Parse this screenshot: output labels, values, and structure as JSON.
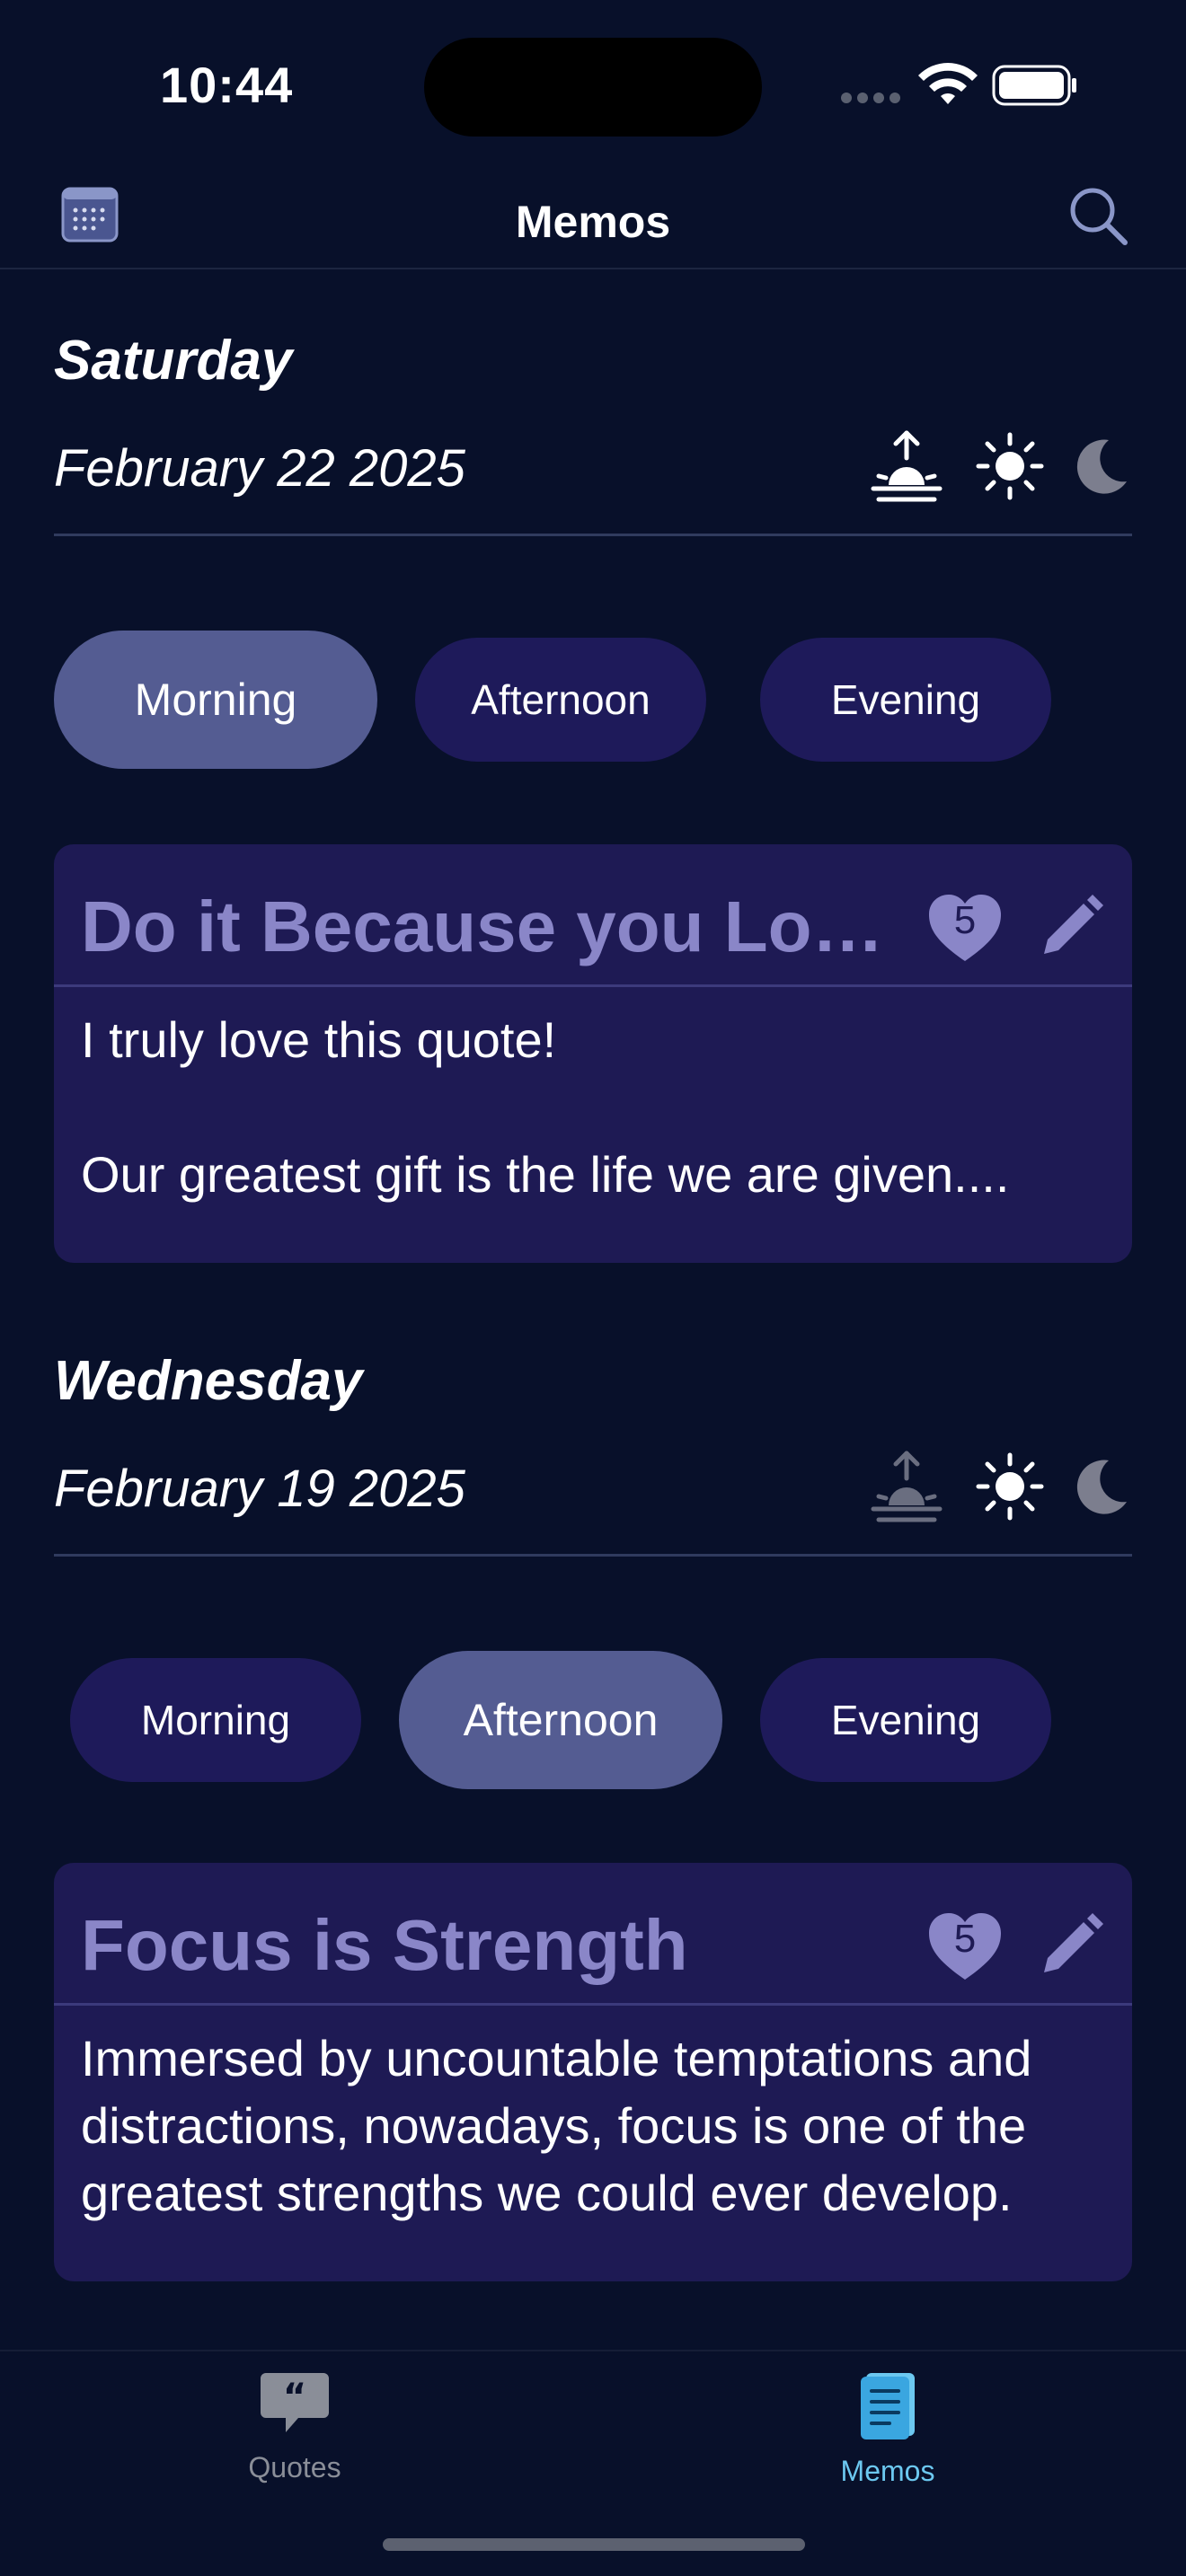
{
  "status_bar": {
    "time": "10:44"
  },
  "nav": {
    "title": "Memos"
  },
  "days": [
    {
      "day": "Saturday",
      "date": "February 22 2025",
      "periods": [
        {
          "label": "Morning",
          "selected": true
        },
        {
          "label": "Afternoon",
          "selected": false
        },
        {
          "label": "Evening",
          "selected": false
        }
      ],
      "memo": {
        "title": "Do it Because you Lov...",
        "likes": "5",
        "body": "I truly love this quote!\n\nOur greatest gift is the life we are given...."
      }
    },
    {
      "day": "Wednesday",
      "date": "February 19 2025",
      "periods": [
        {
          "label": "Morning",
          "selected": false
        },
        {
          "label": "Afternoon",
          "selected": true
        },
        {
          "label": "Evening",
          "selected": false
        }
      ],
      "memo": {
        "title": "Focus is Strength",
        "likes": "5",
        "body": "Immersed by uncountable temptations and distractions, nowadays, focus is one of the greatest strengths we could ever develop."
      }
    }
  ],
  "tabs": [
    {
      "label": "Quotes",
      "icon": "quote-bubble-icon",
      "active": false
    },
    {
      "label": "Memos",
      "icon": "memo-book-icon",
      "active": true
    }
  ],
  "colors": {
    "background": "#08102a",
    "card": "#1e1a54",
    "pill": "#1e1a5a",
    "pill_active": "#545c92",
    "title_muted": "#8a86c8",
    "tab_active": "#6cc8f0",
    "tab_inactive": "#8a8e98"
  }
}
